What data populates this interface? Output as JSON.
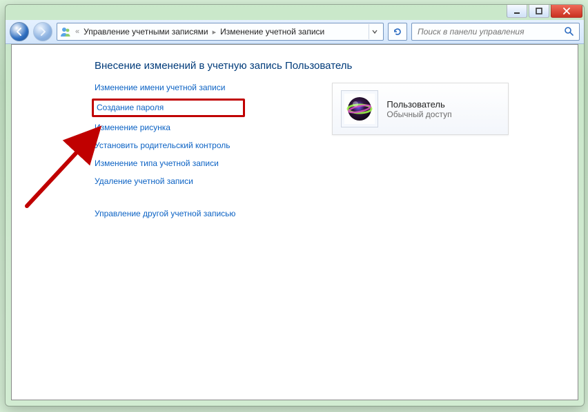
{
  "breadcrumb": {
    "segment1": "Управление учетными записями",
    "segment2": "Изменение учетной записи"
  },
  "search": {
    "placeholder": "Поиск в панели управления"
  },
  "page": {
    "title": "Внесение изменений в учетную запись Пользователь"
  },
  "links": {
    "change_name": "Изменение имени учетной записи",
    "create_password": "Создание пароля",
    "change_picture": "Изменение рисунка",
    "parental": "Установить родительский контроль",
    "change_type": "Изменение типа учетной записи",
    "delete_account": "Удаление учетной записи",
    "manage_other": "Управление другой учетной записью"
  },
  "user": {
    "name": "Пользователь",
    "role": "Обычный доступ"
  }
}
